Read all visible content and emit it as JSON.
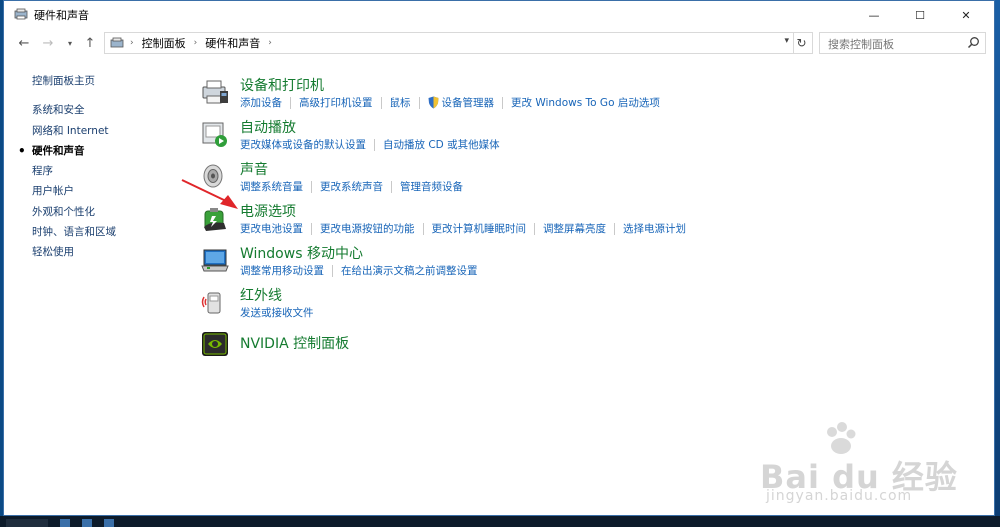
{
  "window": {
    "title": "硬件和声音",
    "minimize_glyph": "—",
    "maximize_glyph": "☐",
    "close_glyph": "✕"
  },
  "address": {
    "crumbs": [
      "控制面板",
      "硬件和声音"
    ],
    "search_placeholder": "搜索控制面板"
  },
  "leftnav": {
    "items": [
      {
        "label": "控制面板主页"
      },
      {
        "label": "系统和安全"
      },
      {
        "label": "网络和 Internet"
      },
      {
        "label": "硬件和声音",
        "active": true
      },
      {
        "label": "程序"
      },
      {
        "label": "用户帐户"
      },
      {
        "label": "外观和个性化"
      },
      {
        "label": "时钟、语言和区域"
      },
      {
        "label": "轻松使用"
      }
    ]
  },
  "categories": [
    {
      "title": "设备和打印机",
      "icon": "printer-icon",
      "links": [
        "添加设备",
        "高级打印机设置",
        "鼠标",
        "设备管理器",
        "更改 Windows To Go 启动选项"
      ]
    },
    {
      "title": "自动播放",
      "icon": "autoplay-icon",
      "links": [
        "更改媒体或设备的默认设置",
        "自动播放 CD 或其他媒体"
      ]
    },
    {
      "title": "声音",
      "icon": "speaker-icon",
      "links": [
        "调整系统音量",
        "更改系统声音",
        "管理音频设备"
      ]
    },
    {
      "title": "电源选项",
      "icon": "power-options-icon",
      "links": [
        "更改电池设置",
        "更改电源按钮的功能",
        "更改计算机睡眠时间",
        "调整屏幕亮度",
        "选择电源计划"
      ]
    },
    {
      "title": "Windows 移动中心",
      "icon": "mobility-center-icon",
      "links": [
        "调整常用移动设置",
        "在给出演示文稿之前调整设置"
      ]
    },
    {
      "title": "红外线",
      "icon": "infrared-icon",
      "links": [
        "发送或接收文件"
      ]
    },
    {
      "title": "NVIDIA 控制面板",
      "icon": "nvidia-icon",
      "links": []
    }
  ],
  "watermark": {
    "brand": "Bai du 经验",
    "url": "jingyan.baidu.com"
  },
  "colors": {
    "category_title": "#157b30",
    "link": "#1865b8",
    "arrow": "#e0262a"
  }
}
